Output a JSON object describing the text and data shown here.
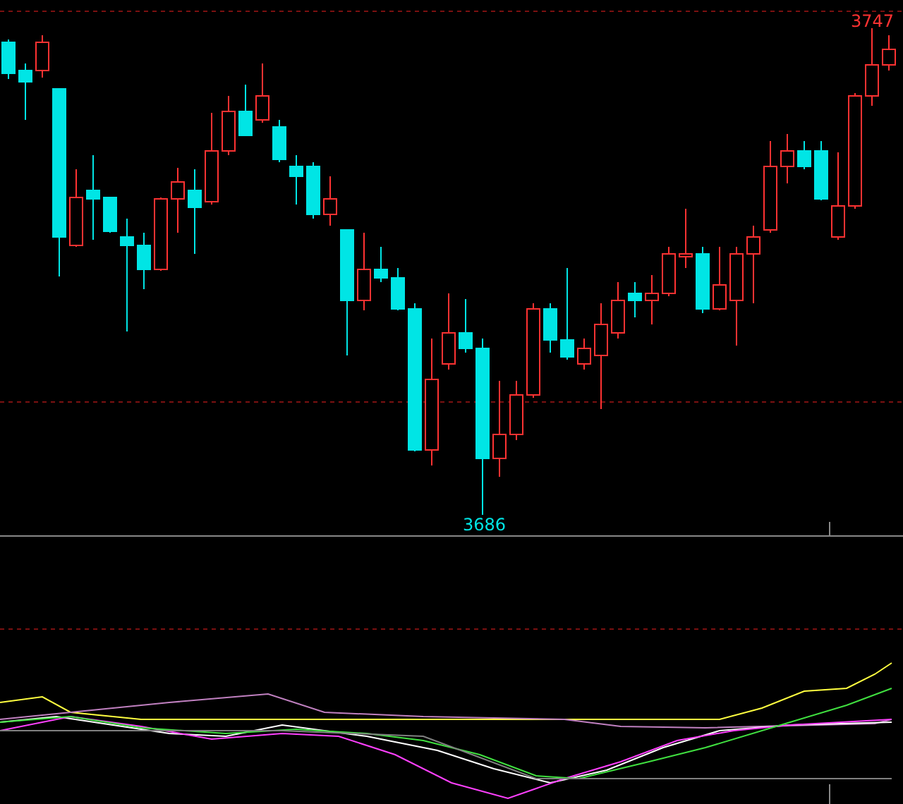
{
  "price_chart": {
    "high_label": "3747",
    "low_label": "3686"
  }
}
